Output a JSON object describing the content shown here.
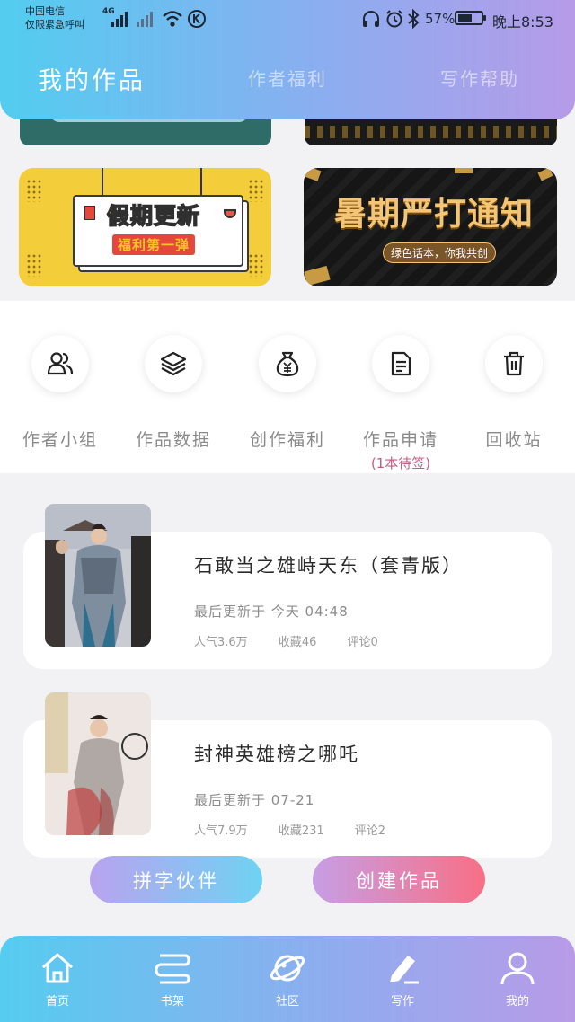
{
  "status_bar": {
    "carrier_line1": "中国电信",
    "carrier_line2": "仅限紧急呼叫",
    "network": "4G",
    "battery": "57%",
    "time": "晚上8:53"
  },
  "tabs": [
    {
      "label": "我的作品",
      "active": true
    },
    {
      "label": "作者福利",
      "active": false
    },
    {
      "label": "写作帮助",
      "active": false
    }
  ],
  "banners": {
    "left": {
      "title": "假期更新",
      "subtitle": "福利第一弹"
    },
    "right": {
      "title": "暑期严打通知",
      "subtitle": "绿色话本，你我共创"
    }
  },
  "actions": [
    {
      "label": "作者小组",
      "icon": "users-icon"
    },
    {
      "label": "作品数据",
      "icon": "layers-icon"
    },
    {
      "label": "创作福利",
      "icon": "money-bag-icon"
    },
    {
      "label": "作品申请",
      "sublabel": "(1本待签)",
      "icon": "document-icon"
    },
    {
      "label": "回收站",
      "icon": "trash-icon"
    }
  ],
  "works": [
    {
      "title": "石敢当之雄峙天东（套青版）",
      "updated": "最后更新于 今天 04:48",
      "popularity": "人气3.6万",
      "favorites": "收藏46",
      "comments": "评论0"
    },
    {
      "title": "封神英雄榜之哪吒",
      "updated": "最后更新于 07-21",
      "popularity": "人气7.9万",
      "favorites": "收藏231",
      "comments": "评论2"
    }
  ],
  "buttons": {
    "partner": "拼字伙伴",
    "create": "创建作品"
  },
  "bottom_nav": [
    {
      "label": "首页",
      "icon": "home-icon"
    },
    {
      "label": "书架",
      "icon": "bookshelf-icon"
    },
    {
      "label": "社区",
      "icon": "planet-icon"
    },
    {
      "label": "写作",
      "icon": "pen-icon"
    },
    {
      "label": "我的",
      "icon": "profile-icon"
    }
  ],
  "colors": {
    "header_gradient": [
      "#52cdf0",
      "#b69be8"
    ],
    "accent_pink": "#c55c84",
    "create_button": [
      "#c79ee6",
      "#f86f85"
    ]
  }
}
